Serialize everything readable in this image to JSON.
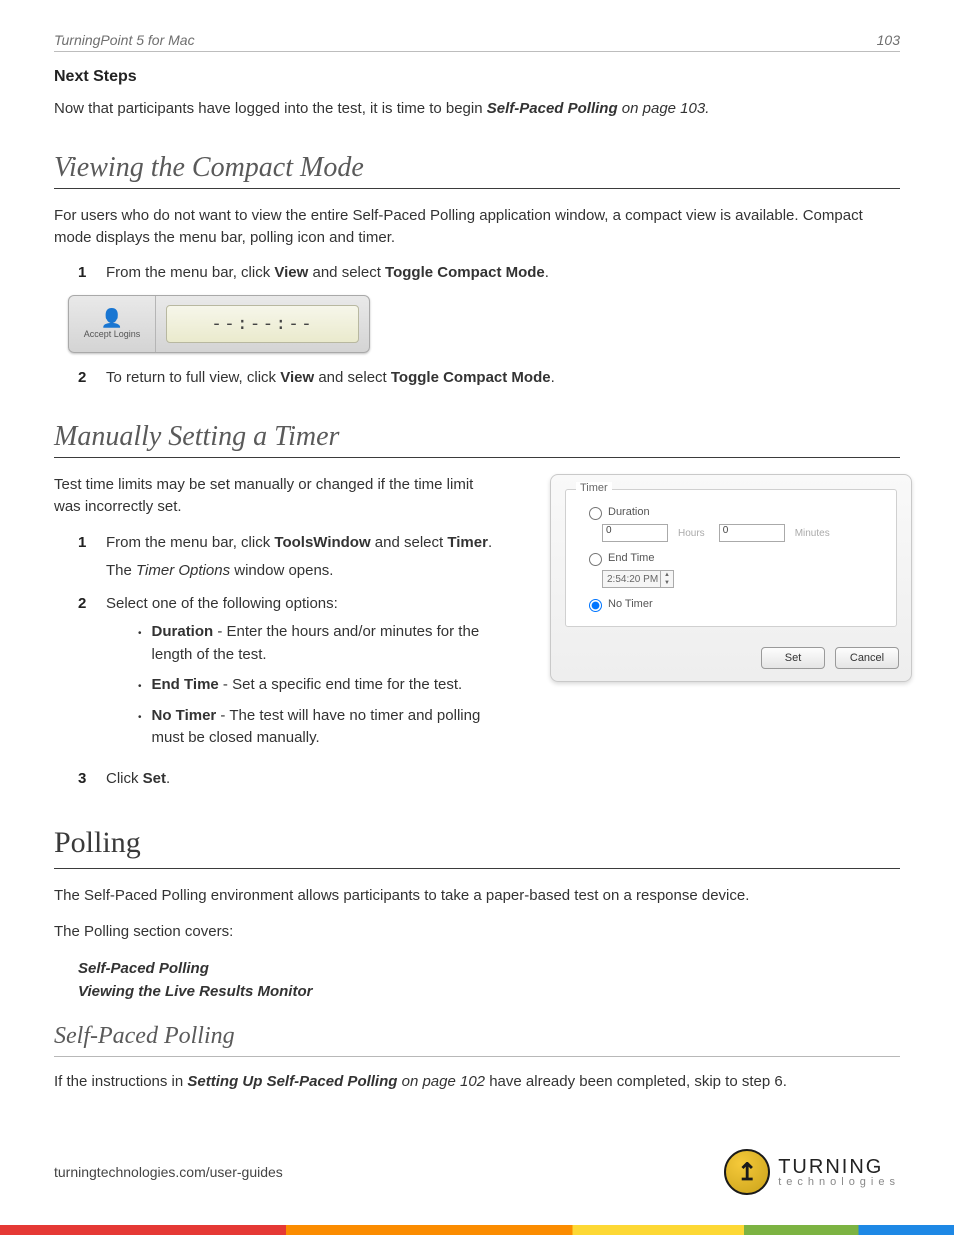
{
  "header": {
    "doc_title": "TurningPoint 5 for Mac",
    "page_number": "103"
  },
  "intro": {
    "next_steps_label": "Next Steps",
    "para_pre": "Now that participants have logged into the test, it is time to begin ",
    "para_link": "Self-Paced Polling",
    "para_ref": " on page 103."
  },
  "compact": {
    "heading": "Viewing the Compact Mode",
    "para": "For users who do not want to view the entire Self-Paced Polling application window, a compact view is available. Compact mode displays the menu bar, polling icon and timer.",
    "step1_pre": "From the menu bar, click ",
    "step1_b1": "View",
    "step1_mid": " and select ",
    "step1_b2": "Toggle Compact Mode",
    "step1_post": ".",
    "img": {
      "login_label": "Accept Logins",
      "timer_text": "--:--:--"
    },
    "step2_pre": "To return to full view, click ",
    "step2_b1": "View",
    "step2_mid": " and select ",
    "step2_b2": "Toggle Compact Mode",
    "step2_post": "."
  },
  "timer": {
    "heading": "Manually Setting a Timer",
    "para": "Test time limits may be set manually or changed if the time limit was incorrectly set.",
    "s1_pre": "From the menu bar, click ",
    "s1_b1": "ToolsWindow",
    "s1_mid": " and select ",
    "s1_b2": "Timer",
    "s1_post": ".",
    "s1_note_pre": "The ",
    "s1_note_em": "Timer Options",
    "s1_note_post": " window opens.",
    "s2": "Select one of the following options:",
    "opt1_b": "Duration",
    "opt1_t": " - Enter the hours and/or minutes for the length of the test.",
    "opt2_b": "End Time",
    "opt2_t": " - Set a specific end time for the test.",
    "opt3_b": "No Timer",
    "opt3_t": " - The test will have no timer and polling must be closed manually.",
    "s3_pre": "Click ",
    "s3_b": "Set",
    "s3_post": ".",
    "dialog": {
      "group_label": "Timer",
      "duration_label": "Duration",
      "hours_value": "0",
      "hours_unit": "Hours",
      "minutes_value": "0",
      "minutes_unit": "Minutes",
      "end_time_label": "End Time",
      "end_time_value": "2:54:20 PM",
      "no_timer_label": "No Timer",
      "btn_set": "Set",
      "btn_cancel": "Cancel"
    }
  },
  "polling": {
    "heading": "Polling",
    "p1": "The Self-Paced Polling environment allows participants to take a paper-based test on a response device.",
    "p2": "The Polling section covers:",
    "link1": "Self-Paced Polling",
    "link2": "Viewing the Live Results Monitor"
  },
  "self_paced": {
    "heading": "Self-Paced Polling",
    "p_pre": "If the instructions in ",
    "p_link": "Setting Up Self-Paced Polling",
    "p_ref": " on page 102",
    "p_post": " have already been completed, skip to step 6."
  },
  "footer": {
    "url": "turningtechnologies.com/user-guides",
    "logo_top": "TURNING",
    "logo_bottom": "technologies"
  }
}
